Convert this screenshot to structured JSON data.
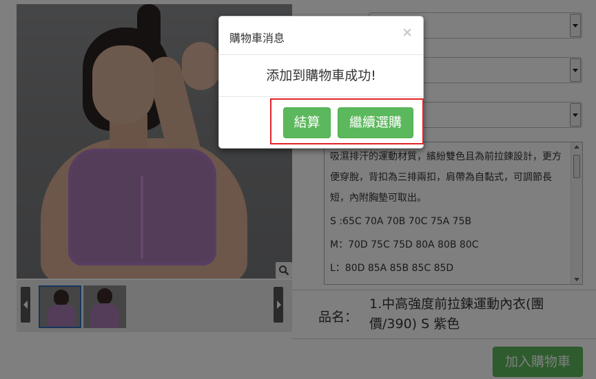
{
  "product": {
    "description": {
      "text": "吸濕排汗的運動材質，繽紛雙色且為前拉鍊設計，更方便穿脫，背扣為三排兩扣，肩帶為自黏式，可調節長短，內附胸墊可取出。",
      "sizes": [
        "S :65C 70A 70B 70C 75A 75B",
        "M：70D 75C 75D 80A 80B 80C",
        "L：80D 85A 85B 85C 85D"
      ]
    },
    "name_label": "品名：",
    "name_value": "1.中高強度前拉鍊運動內衣(團價/390) S 紫色",
    "add_to_cart_label": "加入購物車"
  },
  "modal": {
    "title": "購物車消息",
    "close_label": "×",
    "message": "添加到購物車成功!",
    "checkout_label": "結算",
    "continue_label": "繼續選購"
  },
  "colors": {
    "button_green": "#5cb85c",
    "highlight_red": "#e32227",
    "product_purple": "#a77bb0"
  }
}
